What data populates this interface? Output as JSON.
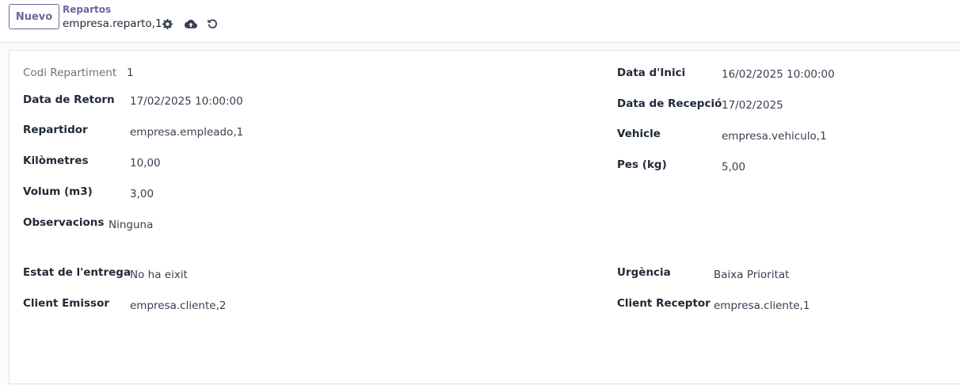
{
  "control_panel": {
    "new_button_label": "Nuevo",
    "breadcrumb": "Repartos",
    "record_name": "empresa.reparto,1",
    "icons": [
      "gear-icon",
      "cloud-upload-icon",
      "undo-icon"
    ]
  },
  "form": {
    "codi_repartiment": {
      "label": "Codi Repartiment",
      "value": "1"
    },
    "data_inici": {
      "label": "Data d'Inici",
      "value": "16/02/2025 10:00:00"
    },
    "data_retorn": {
      "label": "Data de Retorn",
      "value": "17/02/2025 10:00:00"
    },
    "data_recepcio": {
      "label": "Data de Recepció",
      "value": "17/02/2025"
    },
    "repartidor": {
      "label": "Repartidor",
      "value": "empresa.empleado,1"
    },
    "vehicle": {
      "label": "Vehicle",
      "value": "empresa.vehiculo,1"
    },
    "kilometres": {
      "label": "Kilòmetres",
      "value": "10,00"
    },
    "pes": {
      "label": "Pes (kg)",
      "value": "5,00"
    },
    "volum": {
      "label": "Volum (m3)",
      "value": "3,00"
    },
    "observacions": {
      "label": "Observacions",
      "value": "Ninguna"
    },
    "estat_entrega": {
      "label": "Estat de l'entrega",
      "value": "No ha eixit"
    },
    "urgencia": {
      "label": "Urgència",
      "value": "Baixa Prioritat"
    },
    "client_emissor": {
      "label": "Client Emissor",
      "value": "empresa.cliente,2"
    },
    "client_receptor": {
      "label": "Client Receptor",
      "value": "empresa.cliente,1"
    }
  },
  "colors": {
    "accent": "#71639e",
    "label": "#1f2937",
    "muted_label": "#6b7280",
    "border": "#dee2e6"
  }
}
